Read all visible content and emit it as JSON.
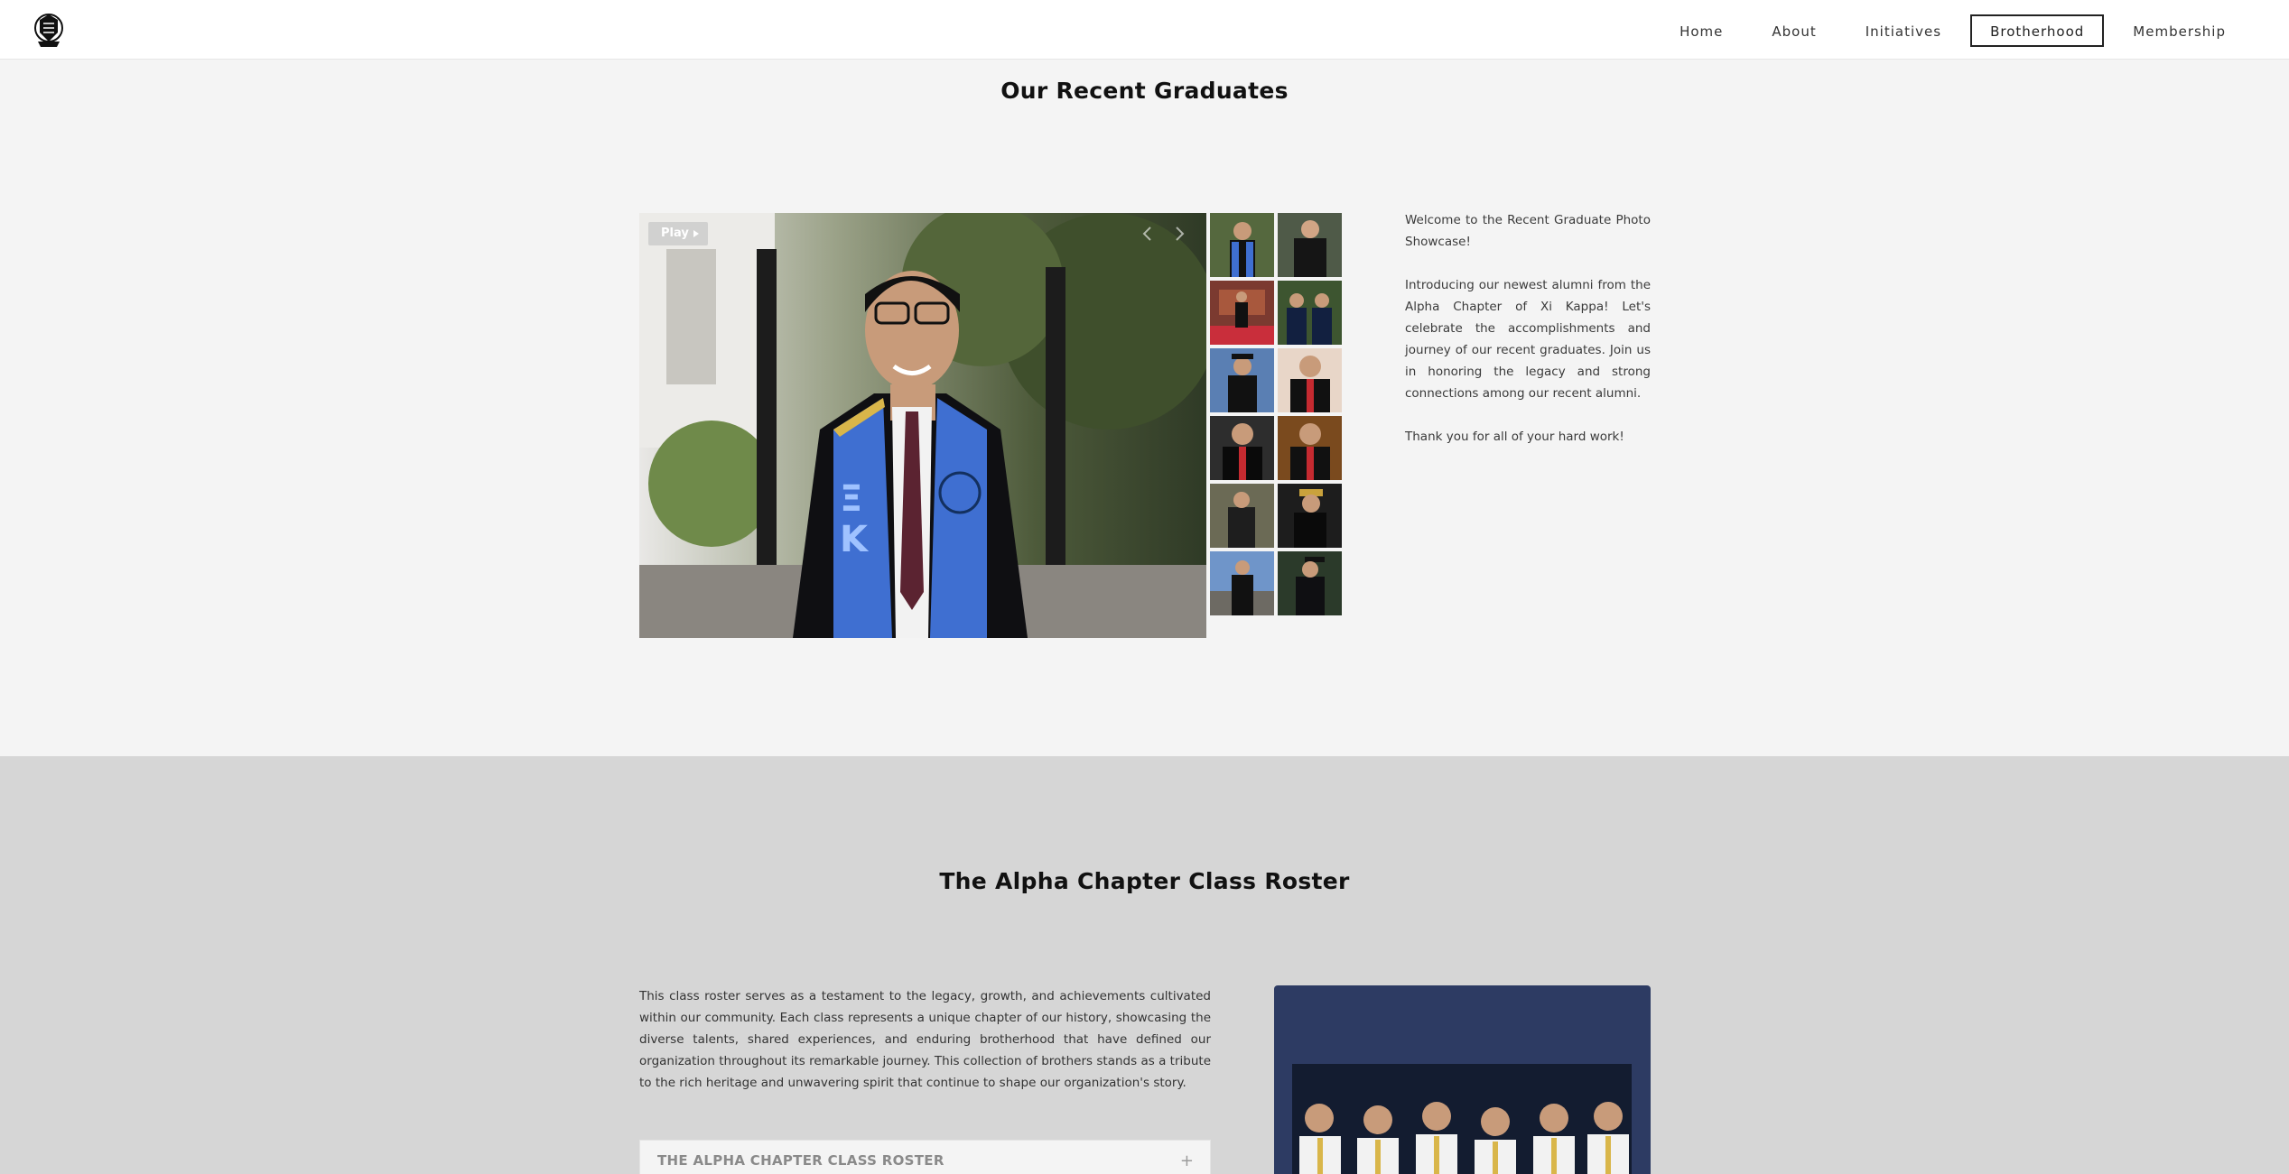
{
  "nav": {
    "logo_icon": "fraternity-crest-icon",
    "links": [
      "Home",
      "About",
      "Initiatives",
      "Brotherhood",
      "Membership"
    ],
    "active": "Brotherhood"
  },
  "graduates": {
    "title": "Our Recent Graduates",
    "slideshow": {
      "play_label": "Play",
      "prev_icon": "chevron-left-icon",
      "next_icon": "chevron-right-icon",
      "thumbnail_count": 12
    },
    "intro": [
      "Welcome to the Recent Graduate Photo Showcase!",
      "Introducing our newest alumni from the Alpha Chapter of Xi Kappa! Let's celebrate the accomplishments and journey of our recent graduates. Join us in honoring the legacy and strong connections among our recent alumni.",
      "Thank you for all of your hard work!"
    ]
  },
  "roster": {
    "title": "The Alpha Chapter Class Roster",
    "description": "This class roster serves as a testament to the legacy, growth, and achievements cultivated within our community. Each class represents a unique chapter of our history, showcasing the diverse talents, shared experiences, and enduring brotherhood that have defined our organization throughout its remarkable journey.  This collection of brothers stands as a tribute to the rich heritage and unwavering spirit that continue to shape our organization's story.",
    "accordion_label": "THE ALPHA CHAPTER CLASS ROSTER",
    "accordion_icon": "plus-icon"
  },
  "colors": {
    "nav_bg": "#ffffff",
    "page_bg": "#f4f4f4",
    "roster_bg": "#d6d6d6",
    "card_bg": "#2d3b63"
  }
}
